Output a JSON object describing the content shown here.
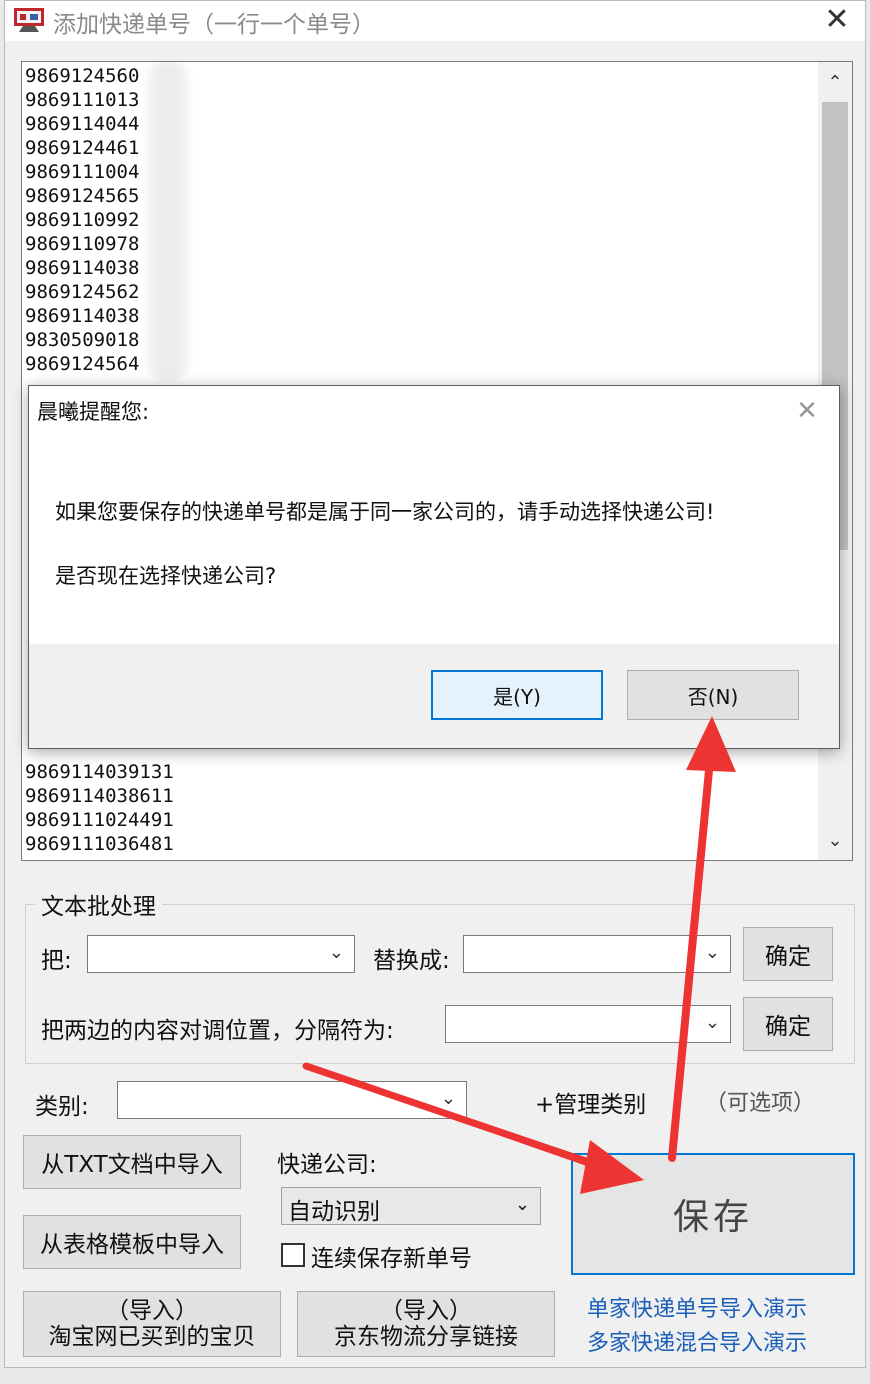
{
  "window": {
    "title": "添加快递单号（一行一个单号）",
    "close_glyph": "✕"
  },
  "number_list": {
    "items": [
      "9869124560",
      "9869111013",
      "9869114044",
      "9869124461",
      "9869111004",
      "9869124565",
      "9869110992",
      "9869110978",
      "9869114038",
      "9869124562",
      "9869114038",
      "9830509018",
      "9869124564",
      "9869114039131",
      "9869114038611",
      "9869111024491",
      "9869111036481"
    ],
    "scroll_up_glyph": "⌃",
    "scroll_down_glyph": "⌄"
  },
  "dialog": {
    "title": "晨曦提醒您:",
    "close_glyph": "✕",
    "message_line1": "如果您要保存的快递单号都是属于同一家公司的，请手动选择快递公司!",
    "message_line2": "是否现在选择快递公司?",
    "yes_label": "是(Y)",
    "no_label": "否(N)"
  },
  "batch": {
    "legend": "文本批处理",
    "find_label": "把:",
    "replace_label": "替换成:",
    "confirm1_label": "确定",
    "swap_label": "把两边的内容对调位置，分隔符为:",
    "confirm2_label": "确定",
    "chevron_glyph": "⌄"
  },
  "category": {
    "label": "类别:",
    "manage_label": "+管理类别",
    "optional_label": "（可选项）"
  },
  "import": {
    "txt_label": "从TXT文档中导入",
    "template_label": "从表格模板中导入",
    "taobao_line1": "（导入）",
    "taobao_line2": "淘宝网已买到的宝贝",
    "jd_line1": "（导入）",
    "jd_line2": "京东物流分享链接"
  },
  "company": {
    "label": "快递公司:",
    "value": "自动识别",
    "continuous_label": "连续保存新单号"
  },
  "save": {
    "label": "保存"
  },
  "demos": {
    "single_label": "单家快递单号导入演示",
    "multi_label": "多家快递混合导入演示"
  },
  "colors": {
    "accent_blue": "#0078d7",
    "annotation_red": "#ee3333",
    "link_blue": "#1b5fb8"
  }
}
